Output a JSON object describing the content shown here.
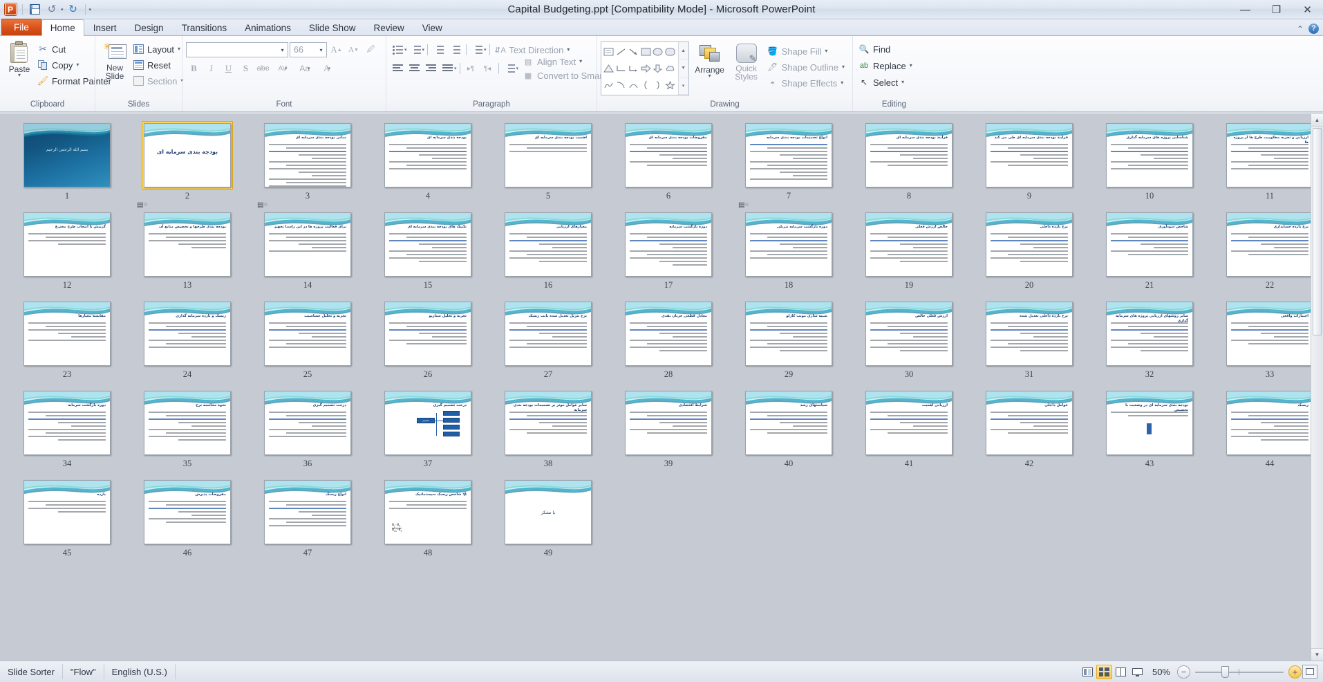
{
  "window": {
    "title": "Capital Budgeting.ppt [Compatibility Mode]  -  Microsoft PowerPoint",
    "minimize": "—",
    "restore": "❐",
    "close": "✕"
  },
  "quick_access": {
    "logo": "P",
    "save": "save-icon",
    "undo": "↺",
    "undo_caret": "▾",
    "redo": "↻",
    "customize": "▾"
  },
  "tabs": [
    {
      "label": "File",
      "kind": "file"
    },
    {
      "label": "Home",
      "kind": "active"
    },
    {
      "label": "Insert",
      "kind": "normal"
    },
    {
      "label": "Design",
      "kind": "normal"
    },
    {
      "label": "Transitions",
      "kind": "normal"
    },
    {
      "label": "Animations",
      "kind": "normal"
    },
    {
      "label": "Slide Show",
      "kind": "normal"
    },
    {
      "label": "Review",
      "kind": "normal"
    },
    {
      "label": "View",
      "kind": "normal"
    }
  ],
  "tab_right": {
    "minimize_ribbon": "⌃",
    "help": "?"
  },
  "ribbon": {
    "clipboard": {
      "label": "Clipboard",
      "paste": "Paste",
      "paste_caret": "▾",
      "cut": "Cut",
      "copy": "Copy",
      "copy_caret": "▾",
      "format_painter": "Format Painter",
      "launcher": "◪"
    },
    "slides": {
      "label": "Slides",
      "new_slide_line1": "New",
      "new_slide_line2": "Slide",
      "new_slide_caret": "▾",
      "layout": "Layout",
      "layout_caret": "▾",
      "reset": "Reset",
      "section": "Section",
      "section_caret": "▾"
    },
    "font": {
      "label": "Font",
      "font_name_value": "",
      "font_size_value": "66",
      "combo_caret": "▾",
      "grow_font": "A",
      "shrink_font": "A",
      "clear_formatting": "A",
      "bold": "B",
      "italic": "I",
      "underline": "U",
      "shadow": "S",
      "strikethrough": "abc",
      "character_spacing": "AV",
      "change_case": "Aa",
      "font_color": "A",
      "launcher": "◪"
    },
    "paragraph": {
      "label": "Paragraph",
      "bullets": "bullets-icon",
      "numbering": "numbering-icon",
      "decrease_indent": "decrease-indent-icon",
      "increase_indent": "increase-indent-icon",
      "line_spacing": "line-spacing-icon",
      "align_left": "align-left-icon",
      "align_center": "align-center-icon",
      "align_right": "align-right-icon",
      "justify": "justify-icon",
      "ltr": "▸¶",
      "rtl": "¶◂",
      "columns": "columns-icon",
      "text_direction": "Text Direction",
      "align_text": "Align Text",
      "convert_to_smartart": "Convert to SmartArt",
      "caret": "▾",
      "launcher": "◪"
    },
    "drawing": {
      "label": "Drawing",
      "arrange": "Arrange",
      "arrange_caret": "▾",
      "quick_styles_l1": "Quick",
      "quick_styles_l2": "Styles",
      "quick_caret": "▾",
      "shape_fill": "Shape Fill",
      "shape_outline": "Shape Outline",
      "shape_effects": "Shape Effects",
      "caret": "▾",
      "gallery_up": "▲",
      "gallery_down": "▼",
      "gallery_more": "▾",
      "launcher": "◪"
    },
    "editing": {
      "label": "Editing",
      "find": "Find",
      "replace": "Replace",
      "replace_caret": "▾",
      "select": "Select",
      "select_caret": "▾"
    }
  },
  "status": {
    "view_mode": "Slide Sorter",
    "theme": "\"Flow\"",
    "language": "English (U.S.)",
    "zoom_level": "50%",
    "zoom_out": "−",
    "zoom_in": "+",
    "fit_to_window": "fit-slide-icon",
    "view_normal": "normal-view-icon",
    "view_sorter": "slide-sorter-icon",
    "view_reading": "reading-view-icon",
    "view_slideshow": "slide-show-icon"
  },
  "scrollbar": {
    "up": "▲",
    "down": "▼"
  },
  "sorter": {
    "selected_slide": 2,
    "total_slides": 49,
    "slides": [
      {
        "n": 1,
        "kind": "title-dark",
        "title": "بسم الله الرحمن الرحیم",
        "anim": false
      },
      {
        "n": 2,
        "kind": "title-big",
        "title": "بودجه بندی سرمایه ای",
        "anim": true
      },
      {
        "n": 3,
        "kind": "body",
        "title": "مبانی بودجه بندی سرمایه ای",
        "lines": 13,
        "anim": true
      },
      {
        "n": 4,
        "kind": "body",
        "title": "بودجه بندی سرمایه ای",
        "lines": 8,
        "anim": false
      },
      {
        "n": 5,
        "kind": "body",
        "title": "اهمیت بودجه بندی سرمایه ای",
        "lines": 3,
        "anim": false
      },
      {
        "n": 6,
        "kind": "body",
        "title": "مفروضات بودجه بندی سرمایه ای",
        "lines": 7,
        "anim": false
      },
      {
        "n": 7,
        "kind": "body-full",
        "title": "انواع تصمیمات بودجه بندی سرمایه",
        "lines": 11,
        "anim": true
      },
      {
        "n": 8,
        "kind": "body",
        "title": "فرآیند بودجه بندی سرمایه ای",
        "lines": 7,
        "anim": false
      },
      {
        "n": 9,
        "kind": "body",
        "title": "فرایند بودجه بندی سرمایه ای طی می کند",
        "lines": 7,
        "anim": false
      },
      {
        "n": 10,
        "kind": "body",
        "title": "شناسایی پروژه های سرمایه گذاری",
        "lines": 8,
        "anim": false
      },
      {
        "n": 11,
        "kind": "body",
        "title": "ارزیابی و تجزیه مطلوبیت طرح ها از پروژه ها",
        "lines": 8,
        "anim": false
      },
      {
        "n": 12,
        "kind": "body",
        "title": "گزینش یا انتخاب طرح مخترع",
        "lines": 4,
        "anim": false
      },
      {
        "n": 13,
        "kind": "body",
        "title": "بودجه بندی طرحها و تخصیص منابع آن",
        "lines": 5,
        "anim": false
      },
      {
        "n": 14,
        "kind": "body",
        "title": "برای فعالیت پروژه ها در این راستا تجهیز",
        "lines": 6,
        "anim": false
      },
      {
        "n": 15,
        "kind": "body",
        "title": "تکنیک های بودجه بندی سرمایه ای",
        "lines": 9,
        "anim": false
      },
      {
        "n": 16,
        "kind": "body",
        "title": "معیارهای ارزیابی",
        "lines": 9,
        "anim": false
      },
      {
        "n": 17,
        "kind": "body",
        "title": "دوره بازگشت سرمایه",
        "lines": 10,
        "anim": false
      },
      {
        "n": 18,
        "kind": "body",
        "title": "دوره بازگشت سرمایه تنزیلی",
        "lines": 8,
        "anim": false
      },
      {
        "n": 19,
        "kind": "body",
        "title": "خالص ارزش فعلی",
        "lines": 9,
        "anim": false
      },
      {
        "n": 20,
        "kind": "body",
        "title": "نرخ بازده داخلی",
        "lines": 9,
        "anim": false
      },
      {
        "n": 21,
        "kind": "body",
        "title": "شاخص سودآوری",
        "lines": 7,
        "anim": false
      },
      {
        "n": 22,
        "kind": "body",
        "title": "نرخ بازده حسابداری",
        "lines": 7,
        "anim": false
      },
      {
        "n": 23,
        "kind": "body",
        "title": "مقایسه معیارها",
        "lines": 6,
        "anim": false
      },
      {
        "n": 24,
        "kind": "body",
        "title": "ریسک و بازده سرمایه گذاری",
        "lines": 8,
        "anim": false
      },
      {
        "n": 25,
        "kind": "body",
        "title": "تجزیه و تحلیل حساسیت",
        "lines": 8,
        "anim": false
      },
      {
        "n": 26,
        "kind": "body",
        "title": "تجزیه و تحلیل سناریو",
        "lines": 7,
        "anim": false
      },
      {
        "n": 27,
        "kind": "body",
        "title": "نرخ تنزیل تعدیل شده بابت ریسک",
        "lines": 8,
        "anim": false
      },
      {
        "n": 28,
        "kind": "body",
        "title": "معادل قطعی جریان نقدی",
        "lines": 9,
        "anim": false
      },
      {
        "n": 29,
        "kind": "body",
        "title": "شبیه سازی مونت کارلو",
        "lines": 9,
        "anim": false
      },
      {
        "n": 30,
        "kind": "body",
        "title": "ارزش فعلی خالص",
        "lines": 9,
        "anim": false
      },
      {
        "n": 31,
        "kind": "body",
        "title": "نرخ بازده داخلی تعدیل شده",
        "lines": 9,
        "anim": false
      },
      {
        "n": 32,
        "kind": "body",
        "title": "سایر روشهای ارزیابی پروژه های سرمایه گذاری",
        "lines": 9,
        "anim": false
      },
      {
        "n": 33,
        "kind": "body",
        "title": "اختیارات واقعی",
        "lines": 7,
        "anim": false
      },
      {
        "n": 34,
        "kind": "body",
        "title": "دوره بازگشت سرمایه",
        "lines": 9,
        "anim": false
      },
      {
        "n": 35,
        "kind": "body",
        "title": "نحوه محاسبه نرخ",
        "lines": 9,
        "anim": false
      },
      {
        "n": 36,
        "kind": "body",
        "title": "درخت تصمیم گیری",
        "lines": 8,
        "anim": false
      },
      {
        "n": 37,
        "kind": "tree",
        "title": "درخت تصمیم گیری",
        "lines": 0,
        "anim": false
      },
      {
        "n": 38,
        "kind": "body",
        "title": "سایر عوامل موثر بر تصمیمات بودجه بندی سرمایه",
        "lines": 7,
        "anim": false
      },
      {
        "n": 39,
        "kind": "body",
        "title": "شرایط اقتصادی",
        "lines": 7,
        "anim": false
      },
      {
        "n": 40,
        "kind": "body",
        "title": "سیاستهای رشد",
        "lines": 7,
        "anim": false
      },
      {
        "n": 41,
        "kind": "body",
        "title": "ارزیابی اهمیت",
        "lines": 7,
        "anim": false
      },
      {
        "n": 42,
        "kind": "body",
        "title": "عوامل داخلی",
        "lines": 7,
        "anim": false
      },
      {
        "n": 43,
        "kind": "chip",
        "title": "بودجه بندی سرمایه ای در وضعیت با تخصیص",
        "lines": 2,
        "anim": false
      },
      {
        "n": 44,
        "kind": "body",
        "title": "ریسک",
        "lines": 9,
        "anim": false
      },
      {
        "n": 45,
        "kind": "body",
        "title": "بازده",
        "lines": 4,
        "anim": false
      },
      {
        "n": 46,
        "kind": "body",
        "title": "مفروضات پذیرش",
        "lines": 7,
        "anim": false
      },
      {
        "n": 47,
        "kind": "body",
        "title": "انواع ریسک",
        "lines": 8,
        "anim": false
      },
      {
        "n": 48,
        "kind": "formula",
        "title": "β: شاخص ریسک سیستماتیک",
        "lines": 3,
        "anim": false
      },
      {
        "n": 49,
        "kind": "thanks",
        "title": "با تشکر",
        "anim": false
      }
    ]
  }
}
